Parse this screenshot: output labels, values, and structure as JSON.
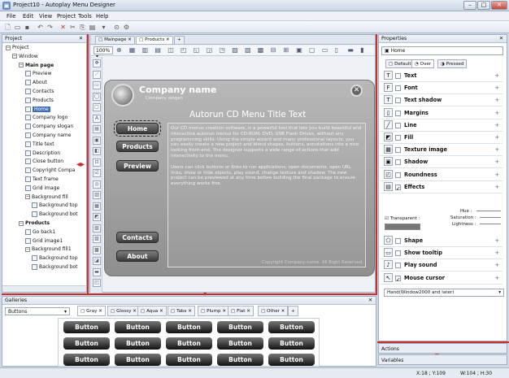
{
  "window": {
    "title": "Project10 - Autoplay Menu Designer"
  },
  "menu": [
    "File",
    "Edit",
    "View",
    "Project",
    "Tools",
    "Help"
  ],
  "project_panel": {
    "title": "Project",
    "close": "✕"
  },
  "tree": [
    {
      "label": "Project",
      "indent": 0,
      "kind": "pm",
      "sym": "−"
    },
    {
      "label": "Window",
      "indent": 1,
      "kind": "pm",
      "sym": "−"
    },
    {
      "label": "Main page",
      "indent": 2,
      "kind": "pm",
      "sym": "−",
      "bold": true
    },
    {
      "label": "Preview",
      "indent": 3
    },
    {
      "label": "About",
      "indent": 3
    },
    {
      "label": "Contacts",
      "indent": 3
    },
    {
      "label": "Products",
      "indent": 3
    },
    {
      "label": "Home",
      "indent": 3,
      "selected": true
    },
    {
      "label": "Company logo",
      "indent": 3
    },
    {
      "label": "Company slogan",
      "indent": 3
    },
    {
      "label": "Company name",
      "indent": 3
    },
    {
      "label": "Title text",
      "indent": 3
    },
    {
      "label": "Description",
      "indent": 3
    },
    {
      "label": "Close button",
      "indent": 3
    },
    {
      "label": "Copyright Compa",
      "indent": 3
    },
    {
      "label": "Text frame",
      "indent": 3
    },
    {
      "label": "Grid image",
      "indent": 3
    },
    {
      "label": "Background fill",
      "indent": 3,
      "kind": "pm",
      "sym": "−"
    },
    {
      "label": "Background top",
      "indent": 4
    },
    {
      "label": "Background bot",
      "indent": 4
    },
    {
      "label": "Products",
      "indent": 2,
      "kind": "pm",
      "sym": "−",
      "bold": true
    },
    {
      "label": "Go back1",
      "indent": 3
    },
    {
      "label": "Grid image1",
      "indent": 3
    },
    {
      "label": "Background fill1",
      "indent": 3,
      "kind": "pm",
      "sym": "−"
    },
    {
      "label": "Background top",
      "indent": 4
    },
    {
      "label": "Background bot",
      "indent": 4
    }
  ],
  "doc_tabs": [
    {
      "label": "Mainpage",
      "active": false
    },
    {
      "label": "Products",
      "active": true
    }
  ],
  "zoom": "100%",
  "canvas": {
    "company_name": "Company name",
    "company_slogan": "Company slogan",
    "title": "Autorun CD Menu Title Text",
    "description1": "Our CD menus creation software, is a powerful tool that lets you build beautiful and interactive autorun menus for CD-ROM, DVD, USB Flash Drives, without any programming skills. Using the simple wizard and many professional layouts, you can easily create a new project and blend shapes, buttons, annotations into a nice looking front-end. The designer supports a wide range of actions that add interactivity to the menu.",
    "description2": "Users can click buttons or links to run applications, open documents, open URL links, show or hide objects, play sound, change texture and shadow. The new project can be previewed at any time before building the final package to ensure everything works fine.",
    "copyright": "Copyright Company name. All Right Reserved.",
    "buttons": [
      "Home",
      "Products",
      "Preview",
      "Contacts",
      "About"
    ]
  },
  "properties": {
    "title": "Properties",
    "close": "✕",
    "object_name": "Home",
    "state_tabs": [
      "Default",
      "Over",
      "Pressed"
    ],
    "rows": [
      {
        "label": "Text",
        "icon": "T"
      },
      {
        "label": "Font",
        "icon": "F"
      },
      {
        "label": "Text shadow",
        "icon": "T"
      },
      {
        "label": "Margins",
        "icon": "▯"
      },
      {
        "label": "Line",
        "icon": "╱"
      },
      {
        "label": "Fill",
        "icon": "◩"
      },
      {
        "label": "Texture image",
        "icon": "▦"
      },
      {
        "label": "Shadow",
        "icon": "▣"
      },
      {
        "label": "Roundness",
        "icon": "◰"
      },
      {
        "label": "Effects",
        "icon": "▤",
        "checked": true
      }
    ],
    "transparent_label": "Transparent :",
    "hue_label": "Hue :",
    "saturation_label": "Saturation :",
    "lightness_label": "Lightness :",
    "rows2": [
      {
        "label": "Shape",
        "icon": "⬠"
      },
      {
        "label": "Show tooltip",
        "icon": "▭"
      },
      {
        "label": "Play sound",
        "icon": "♪"
      },
      {
        "label": "Mouse cursor",
        "icon": "↖",
        "checked": true
      }
    ],
    "cursor_value": "Hand(Window2000 and later)",
    "actions": "Actions",
    "variables": "Variables"
  },
  "galleries": {
    "title": "Galleries",
    "close": "✕",
    "combo_value": "Buttons",
    "tabs": [
      "Gray",
      "Glossy",
      "Aqua",
      "Tabs",
      "Plump",
      "Flat",
      "Other"
    ],
    "button_label": "Button",
    "rows": 3,
    "cols": 5
  },
  "status": {
    "xy": "X:18 ; Y:109",
    "wh": "W:104 ; H:30"
  }
}
